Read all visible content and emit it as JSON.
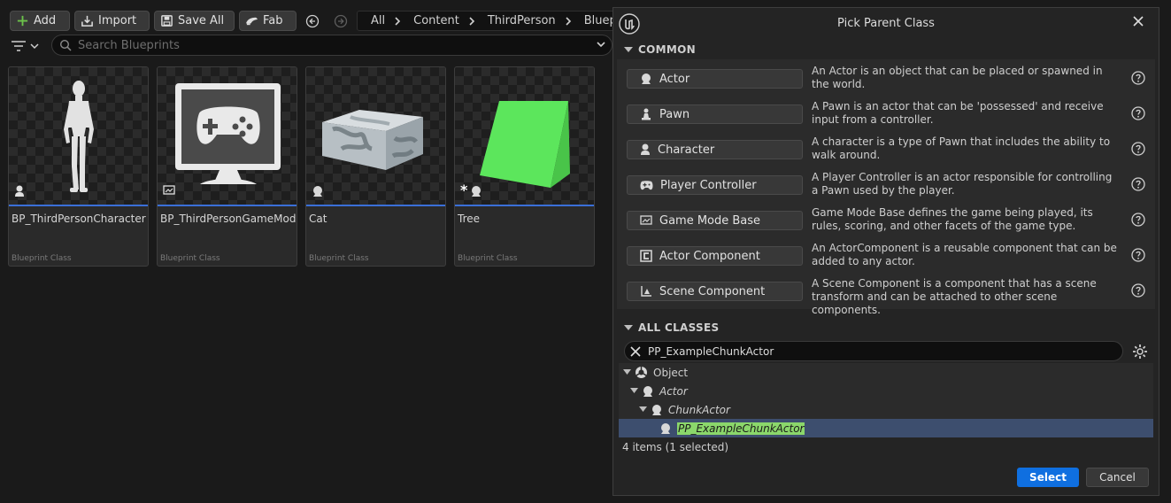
{
  "toolbar": {
    "add_label": "Add",
    "import_label": "Import",
    "save_all_label": "Save All",
    "fab_label": "Fab",
    "breadcrumbs": [
      "All",
      "Content",
      "ThirdPerson",
      "Blueprints"
    ]
  },
  "search": {
    "placeholder": "Search Blueprints"
  },
  "assets": [
    {
      "name": "BP_ThirdPersonCharacter",
      "type": "Blueprint Class",
      "icon": "character-icon"
    },
    {
      "name": "BP_ThirdPersonGameMode",
      "type": "Blueprint Class",
      "icon": "game-mode-icon"
    },
    {
      "name": "Cat",
      "type": "Blueprint Class",
      "icon": "actor-icon"
    },
    {
      "name": "Tree",
      "type": "Blueprint Class",
      "icon": "actor-icon"
    }
  ],
  "dialog": {
    "title": "Pick Parent Class",
    "common_header": "COMMON",
    "common_classes": [
      {
        "label": "Actor",
        "description": "An Actor is an object that can be placed or spawned in the world.",
        "icon": "actor-icon"
      },
      {
        "label": "Pawn",
        "description": "A Pawn is an actor that can be 'possessed' and receive input from a controller.",
        "icon": "pawn-icon"
      },
      {
        "label": "Character",
        "description": "A character is a type of Pawn that includes the ability to walk around.",
        "icon": "character-icon"
      },
      {
        "label": "Player Controller",
        "description": "A Player Controller is an actor responsible for controlling a Pawn used by the player.",
        "icon": "gamepad-icon"
      },
      {
        "label": "Game Mode Base",
        "description": "Game Mode Base defines the game being played, its rules, scoring, and other facets of the game type.",
        "icon": "game-mode-icon"
      },
      {
        "label": "Actor Component",
        "description": "An ActorComponent is a reusable component that can be added to any actor.",
        "icon": "component-icon"
      },
      {
        "label": "Scene Component",
        "description": "A Scene Component is a component that has a scene transform and can be attached to other scene components.",
        "icon": "scene-component-icon"
      }
    ],
    "all_classes_header": "ALL CLASSES",
    "class_search_value": "PP_ExampleChunkActor",
    "tree": [
      {
        "label": "Object",
        "italic": false,
        "selected": false
      },
      {
        "label": "Actor",
        "italic": true,
        "selected": false
      },
      {
        "label": "ChunkActor",
        "italic": true,
        "selected": false
      },
      {
        "label": "PP_ExampleChunkActor",
        "italic": true,
        "selected": true
      }
    ],
    "status": "4 items (1 selected)",
    "select_label": "Select",
    "cancel_label": "Cancel"
  }
}
